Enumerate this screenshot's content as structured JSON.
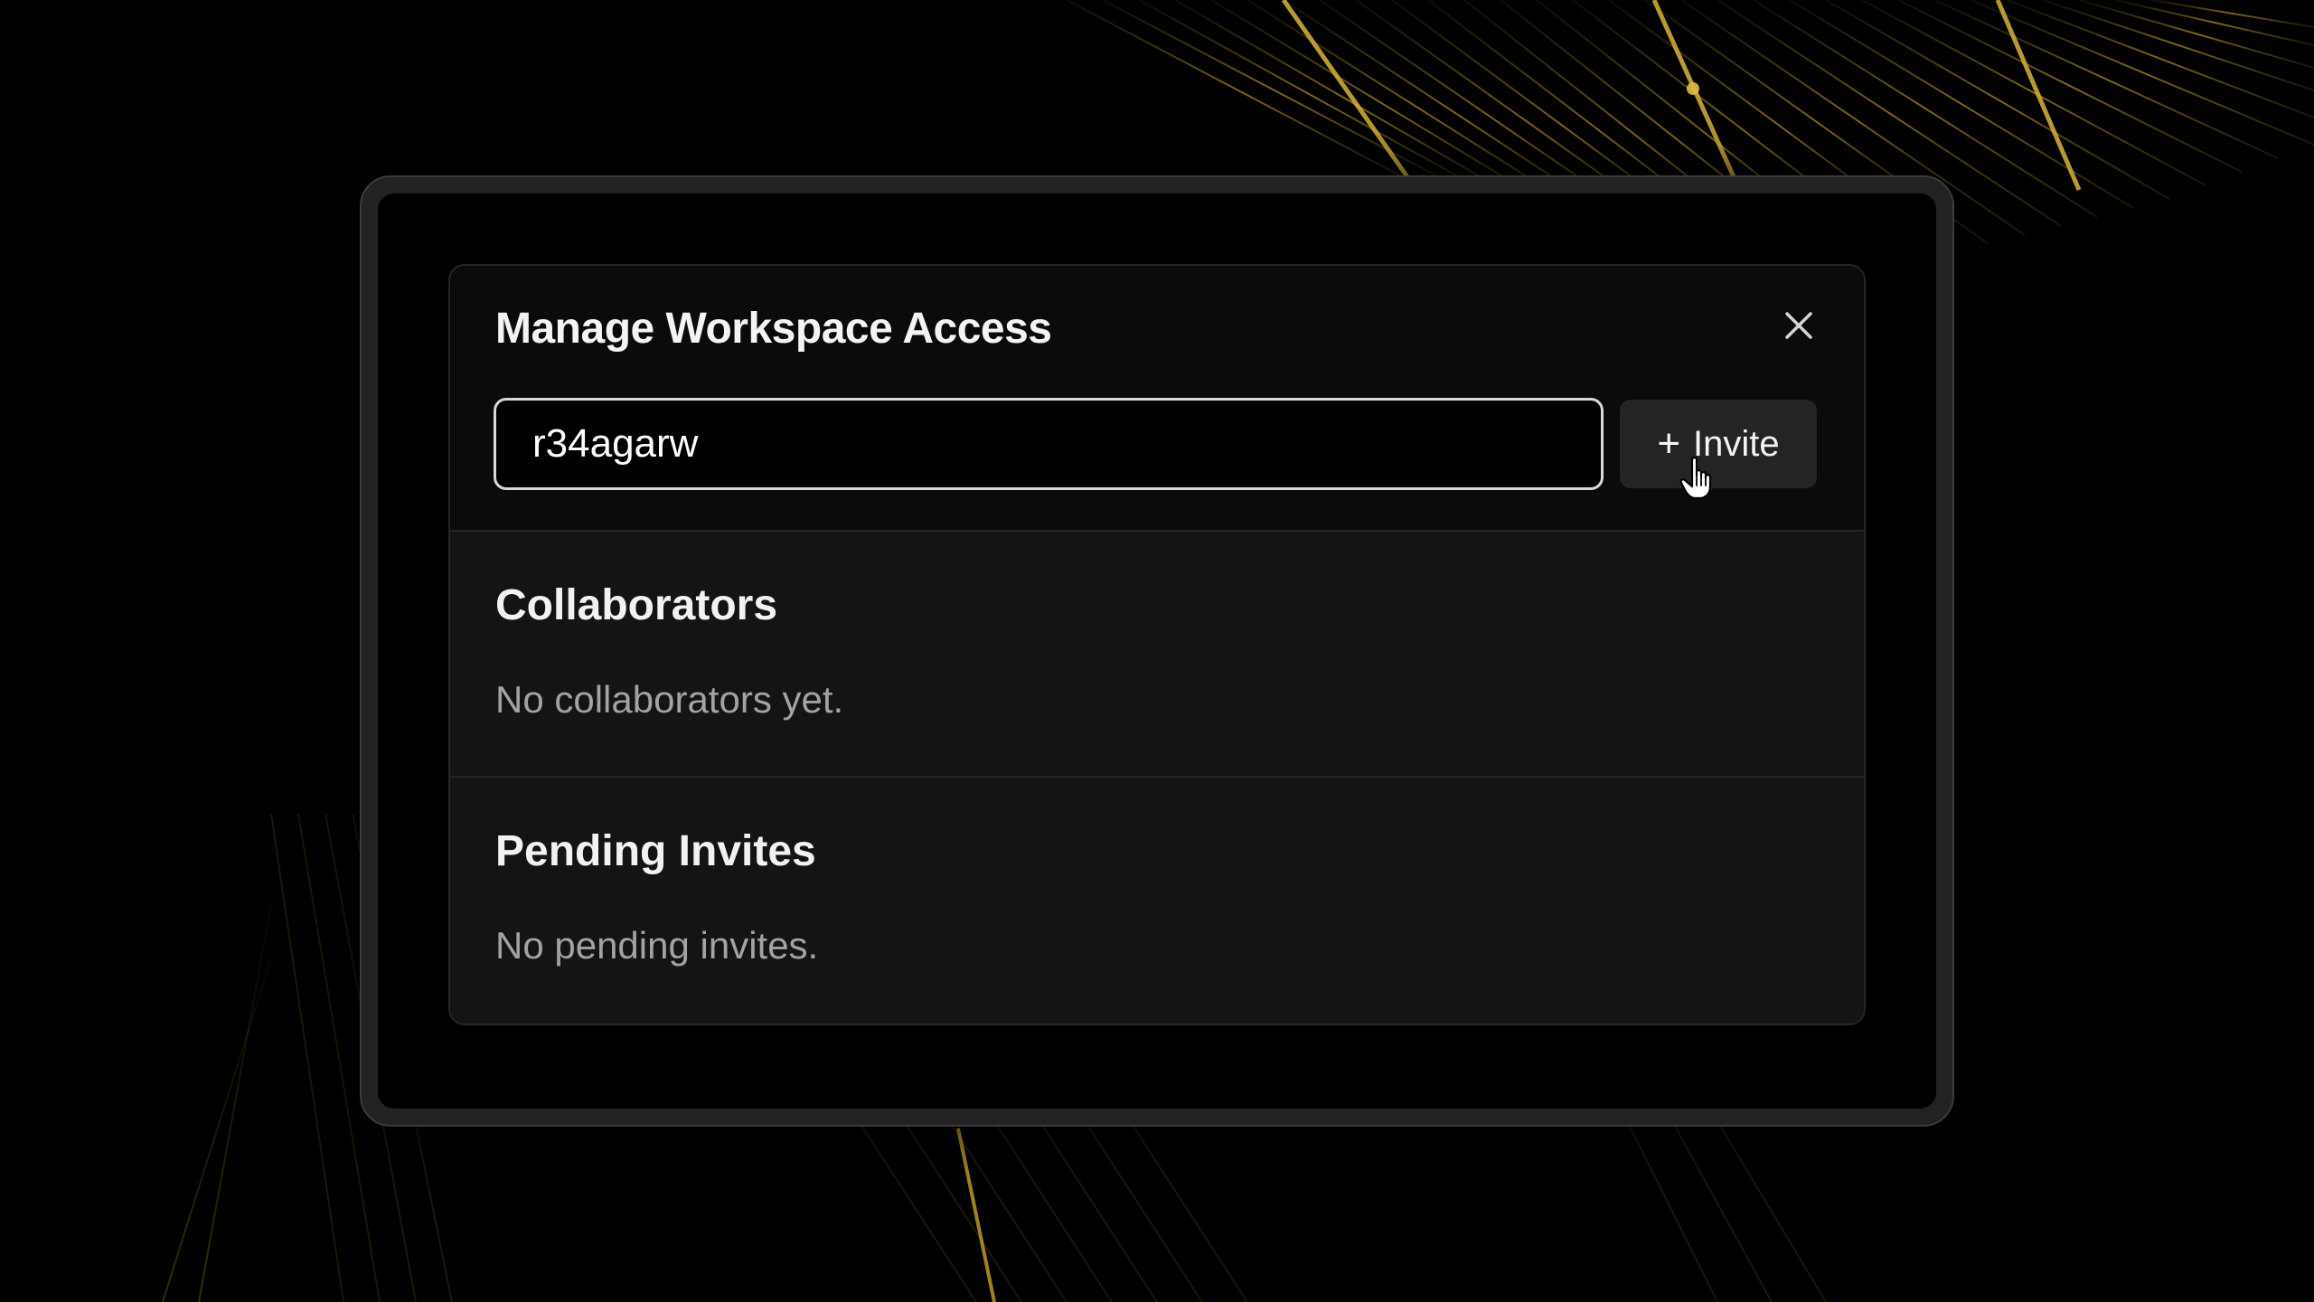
{
  "modal": {
    "title": "Manage Workspace Access",
    "close_icon": "close-icon",
    "invite_input": {
      "value": "r34agarw",
      "placeholder": ""
    },
    "invite_button": {
      "icon": "plus-icon",
      "icon_glyph": "+",
      "label": "Invite"
    }
  },
  "collaborators": {
    "title": "Collaborators",
    "empty_text": "No collaborators yet."
  },
  "pending_invites": {
    "title": "Pending Invites",
    "empty_text": "No pending invites."
  },
  "colors": {
    "background": "#000000",
    "modal_surface": "#141414",
    "modal_header": "#0b0b0b",
    "accent_gold": "#c9a227"
  }
}
